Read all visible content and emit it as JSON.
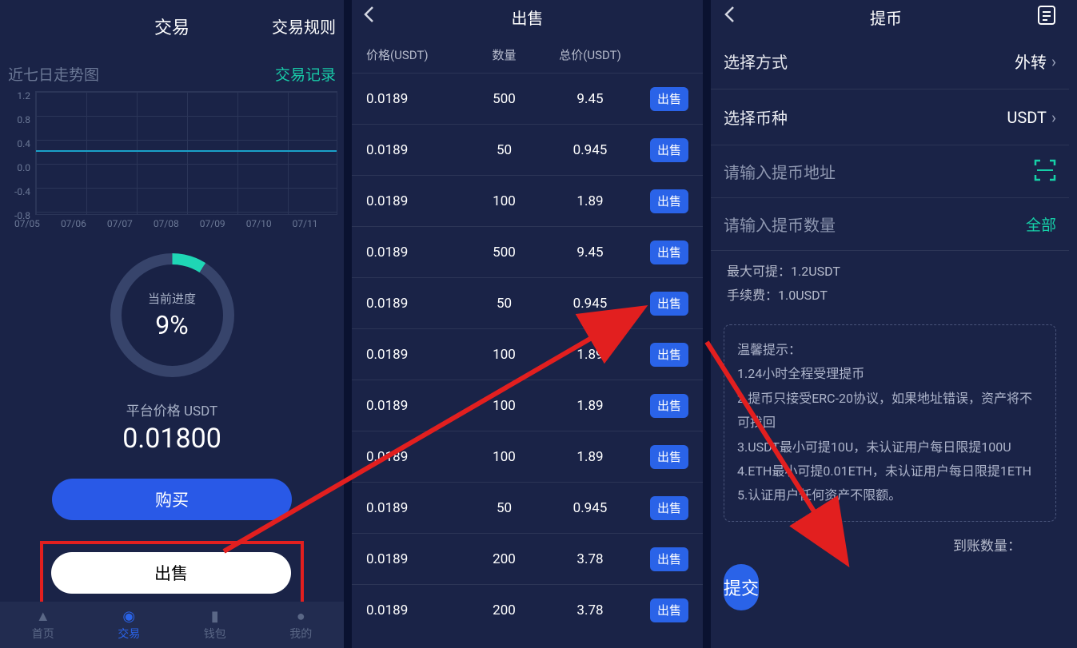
{
  "screen1": {
    "title": "交易",
    "rules_label": "交易规则",
    "chart_label": "近七日走势图",
    "records_label": "交易记录",
    "y_ticks": [
      "1.2",
      "0.8",
      "0.4",
      "0.0",
      "-0.4",
      "-0.8"
    ],
    "x_ticks": [
      "07/05",
      "07/06",
      "07/07",
      "07/08",
      "07/09",
      "07/10",
      "07/11"
    ],
    "gauge_label": "当前进度",
    "gauge_pct": "9%",
    "price_label": "平台价格 USDT",
    "price": "0.01800",
    "buy_label": "购买",
    "sell_label": "出售",
    "tabs": {
      "home": "首页",
      "trade": "交易",
      "wallet": "钱包",
      "me": "我的"
    }
  },
  "screen2": {
    "title": "出售",
    "cols": {
      "price": "价格(USDT)",
      "qty": "数量",
      "total": "总价(USDT)"
    },
    "row_btn": "出售",
    "rows": [
      {
        "price": "0.0189",
        "qty": "500",
        "total": "9.45"
      },
      {
        "price": "0.0189",
        "qty": "50",
        "total": "0.945"
      },
      {
        "price": "0.0189",
        "qty": "100",
        "total": "1.89"
      },
      {
        "price": "0.0189",
        "qty": "500",
        "total": "9.45"
      },
      {
        "price": "0.0189",
        "qty": "50",
        "total": "0.945"
      },
      {
        "price": "0.0189",
        "qty": "100",
        "total": "1.89"
      },
      {
        "price": "0.0189",
        "qty": "100",
        "total": "1.89"
      },
      {
        "price": "0.0189",
        "qty": "100",
        "total": "1.89"
      },
      {
        "price": "0.0189",
        "qty": "50",
        "total": "0.945"
      },
      {
        "price": "0.0189",
        "qty": "200",
        "total": "3.78"
      },
      {
        "price": "0.0189",
        "qty": "200",
        "total": "3.78"
      }
    ]
  },
  "screen3": {
    "title": "提币",
    "method_label": "选择方式",
    "method_value": "外转",
    "coin_label": "选择币种",
    "coin_value": "USDT",
    "addr_placeholder": "请输入提币地址",
    "amt_placeholder": "请输入提币数量",
    "all_label": "全部",
    "max_label": "最大可提：1.2USDT",
    "fee_label": "手续费：1.0USDT",
    "tip_title": "温馨提示：",
    "tip1": "1.24小时全程受理提币",
    "tip2": "2.提币只接受ERC-20协议，如果地址错误，资产将不可找回",
    "tip3": "3.USDT最小可提10U，未认证用户每日限提100U",
    "tip4": "4.ETH最小可提0.01ETH，未认证用户每日限提1ETH",
    "tip5": "5.认证用户任何资产不限额。",
    "credit_label": "到账数量：",
    "submit_label": "提交"
  },
  "chart_data": {
    "type": "line",
    "title": "近七日走势图",
    "xlabel": "",
    "ylabel": "",
    "ylim": [
      -0.8,
      1.2
    ],
    "categories": [
      "07/05",
      "07/06",
      "07/07",
      "07/08",
      "07/09",
      "07/10",
      "07/11"
    ],
    "values": [
      0.02,
      0.02,
      0.02,
      0.02,
      0.02,
      0.02,
      0.02
    ]
  }
}
